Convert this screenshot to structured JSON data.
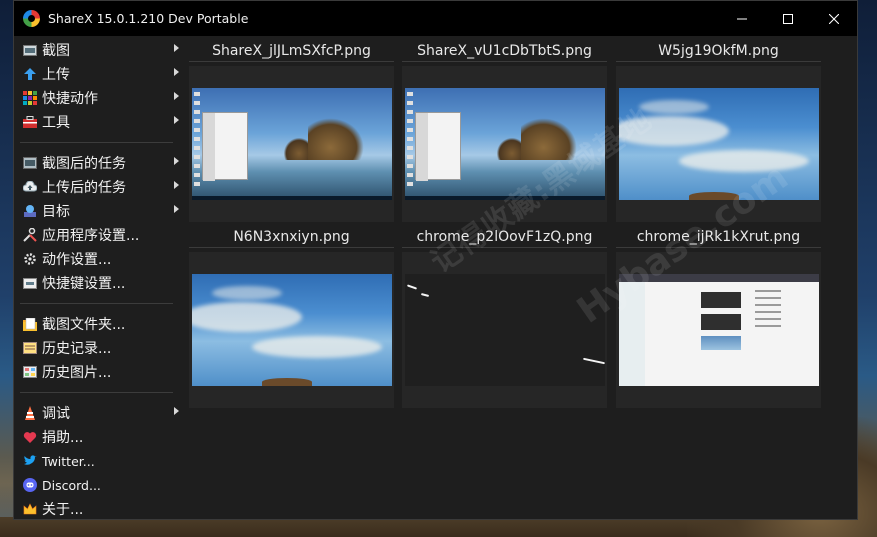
{
  "window": {
    "title": "ShareX 15.0.1.210 Dev Portable",
    "controls": {
      "minimize": "—",
      "maximize": "☐",
      "close": "✕"
    }
  },
  "sidebar": {
    "groups": [
      [
        {
          "label": "截图",
          "icon": "screenshot-icon",
          "submenu": true
        },
        {
          "label": "上传",
          "icon": "upload-arrow-icon",
          "submenu": true
        },
        {
          "label": "快捷动作",
          "icon": "quick-actions-icon",
          "submenu": true
        },
        {
          "label": "工具",
          "icon": "toolbox-icon",
          "submenu": true
        }
      ],
      [
        {
          "label": "截图后的任务",
          "icon": "after-capture-icon",
          "submenu": true
        },
        {
          "label": "上传后的任务",
          "icon": "cloud-upload-icon",
          "submenu": true
        },
        {
          "label": "目标",
          "icon": "destinations-icon",
          "submenu": true
        },
        {
          "label": "应用程序设置...",
          "icon": "wrench-icon",
          "submenu": false
        },
        {
          "label": "动作设置...",
          "icon": "gear-icon",
          "submenu": false
        },
        {
          "label": "快捷键设置...",
          "icon": "keyboard-icon",
          "submenu": false
        }
      ],
      [
        {
          "label": "截图文件夹...",
          "icon": "folder-icon",
          "submenu": false
        },
        {
          "label": "历史记录...",
          "icon": "history-icon",
          "submenu": false
        },
        {
          "label": "历史图片...",
          "icon": "image-history-icon",
          "submenu": false
        }
      ],
      [
        {
          "label": "调试",
          "icon": "debug-icon",
          "submenu": true
        },
        {
          "label": "捐助...",
          "icon": "heart-icon",
          "submenu": false
        },
        {
          "label": "Twitter...",
          "icon": "twitter-icon",
          "submenu": false
        },
        {
          "label": "Discord...",
          "icon": "discord-icon",
          "submenu": false
        },
        {
          "label": "关于...",
          "icon": "crown-icon",
          "submenu": false
        }
      ]
    ]
  },
  "thumbnails": [
    {
      "filename": "ShareX_jlJLmSXfcP.png",
      "kind": "desktop"
    },
    {
      "filename": "ShareX_vU1cDbTbtS.png",
      "kind": "desktop"
    },
    {
      "filename": "W5jg19OkfM.png",
      "kind": "sky"
    },
    {
      "filename": "N6N3xnxiyn.png",
      "kind": "sky"
    },
    {
      "filename": "chrome_p2lOovF1zQ.png",
      "kind": "dark"
    },
    {
      "filename": "chrome_ijRk1kXrut.png",
      "kind": "chrome"
    }
  ],
  "watermark": {
    "line1": "记得收藏:黑域基地",
    "line2": "Hybase.com"
  }
}
